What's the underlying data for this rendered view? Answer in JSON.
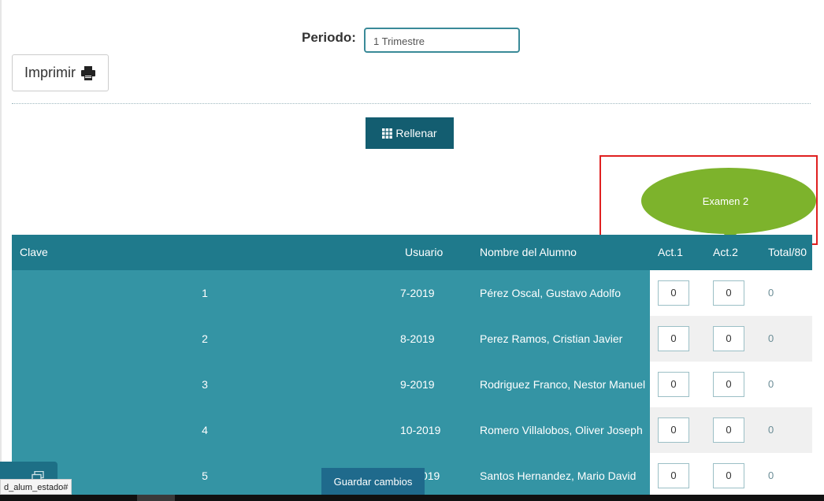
{
  "periodo": {
    "label": "Periodo:",
    "value": "1 Trimestre"
  },
  "toolbar": {
    "print_label": "Imprimir",
    "fill_label": "Rellenar",
    "save_label": "Guardar cambios"
  },
  "callout": {
    "text": "Examen 2"
  },
  "table": {
    "headers": {
      "clave": "Clave",
      "usuario": "Usuario",
      "nombre": "Nombre del Alumno",
      "act1": "Act.1",
      "act2": "Act.2",
      "total": "Total/80"
    },
    "rows": [
      {
        "clave": "1",
        "usuario": "7-2019",
        "nombre": "Pérez Oscal, Gustavo Adolfo",
        "act1": "0",
        "act2": "0",
        "total": "0"
      },
      {
        "clave": "2",
        "usuario": "8-2019",
        "nombre": "Perez Ramos, Cristian Javier",
        "act1": "0",
        "act2": "0",
        "total": "0"
      },
      {
        "clave": "3",
        "usuario": "9-2019",
        "nombre": "Rodriguez Franco, Nestor Manuel",
        "act1": "0",
        "act2": "0",
        "total": "0"
      },
      {
        "clave": "4",
        "usuario": "10-2019",
        "nombre": "Romero Villalobos, Oliver Joseph",
        "act1": "0",
        "act2": "0",
        "total": "0"
      },
      {
        "clave": "5",
        "usuario": "11-2019",
        "nombre": "Santos Hernandez, Mario David",
        "act1": "0",
        "act2": "0",
        "total": "0"
      }
    ]
  },
  "status_bar": {
    "url": "d_alum_estado#"
  },
  "colors": {
    "header_teal": "#1f7a8c",
    "row_teal": "#3494a4",
    "button_dark": "#135d70",
    "callout_green": "#7db32c",
    "highlight_red": "#e02020"
  }
}
